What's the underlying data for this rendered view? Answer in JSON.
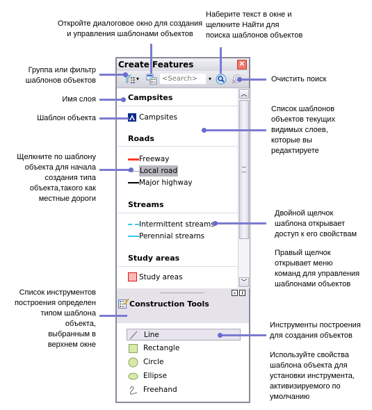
{
  "annotations": {
    "open_dialog": "Откройте диалоговое окно для создания\nи управления шаблонами объектов",
    "search_text": "Наберите текст в окне и\nщелкните Найти для\nпоиска шаблонов объектов",
    "group_filter": "Группа или фильтр\nшаблонов объектов",
    "clear_search": "Очистить поиск",
    "layer_name": "Имя слоя",
    "feature_template": "Шаблон объекта",
    "templates_list": "Список шаблонов\nобъектов текущих\nвидимых слоев,\nкоторые вы\nредактируете",
    "click_template": "Щелкните по шаблону\nобъекта для начала\nсоздания типа\nобъекта,такого как\nместные дороги",
    "double_click": "Двойной щелчок\nшаблона открывает\nдоступ к его свойствам",
    "right_click": "Правый щелчок\nоткрывает меню\nкоманд для управления\nшаблонами объектов",
    "tools_list": "Список инструментов\nпостроения определен\nтипом шаблона\nобъекта,\nвыбранным  в\nверхнем окне",
    "construction_tools": "Инструменты построения\nдля создания объектов",
    "use_properties": "Используйте свойства\nшаблона объекта для\nустановки инструмента,\nактивизируемого по\nумолчанию"
  },
  "window": {
    "title": "Create Features",
    "close_icon": "close-icon",
    "toolbar": {
      "organize_icon": "filter-group-icon",
      "dropdown_glyph": "▾",
      "manage_icon": "organize-templates-icon",
      "search_placeholder": "<Search>",
      "search_dd_glyph": "▾",
      "search_icon": "search-icon",
      "clear_icon": "clear-search-icon"
    },
    "groups": [
      {
        "name": "Campsites",
        "items": [
          {
            "label": "Campsites",
            "symbol": "campsite-marker"
          }
        ]
      },
      {
        "name": "Roads",
        "items": [
          {
            "label": "Freeway",
            "symbol": "line",
            "color": "#ff3b1f"
          },
          {
            "label": "Local road",
            "symbol": "line",
            "color": "#a0a0a8",
            "selected": true
          },
          {
            "label": "Major highway",
            "symbol": "line",
            "color": "#000000"
          }
        ]
      },
      {
        "name": "Streams",
        "items": [
          {
            "label": "Intermittent streams",
            "symbol": "dashed-line",
            "color": "#33c6f0"
          },
          {
            "label": "Perennial streams",
            "symbol": "line",
            "color": "#33c6f0"
          }
        ]
      },
      {
        "name": "Study areas",
        "items": [
          {
            "label": "Study areas",
            "symbol": "polygon",
            "color": "#f8b8b8",
            "stroke": "#e01010"
          }
        ]
      }
    ],
    "construction_tools": {
      "title": "Construction Tools",
      "tools": [
        {
          "label": "Line",
          "icon": "line-tool-icon",
          "selected": true
        },
        {
          "label": "Rectangle",
          "icon": "rectangle-tool-icon"
        },
        {
          "label": "Circle",
          "icon": "circle-tool-icon"
        },
        {
          "label": "Ellipse",
          "icon": "ellipse-tool-icon"
        },
        {
          "label": "Freehand",
          "icon": "freehand-tool-icon"
        }
      ]
    },
    "colors": {
      "callout": "#7b7bd0",
      "selection": "#b8b8c0",
      "tool_selected": "#e8e4ee"
    }
  }
}
